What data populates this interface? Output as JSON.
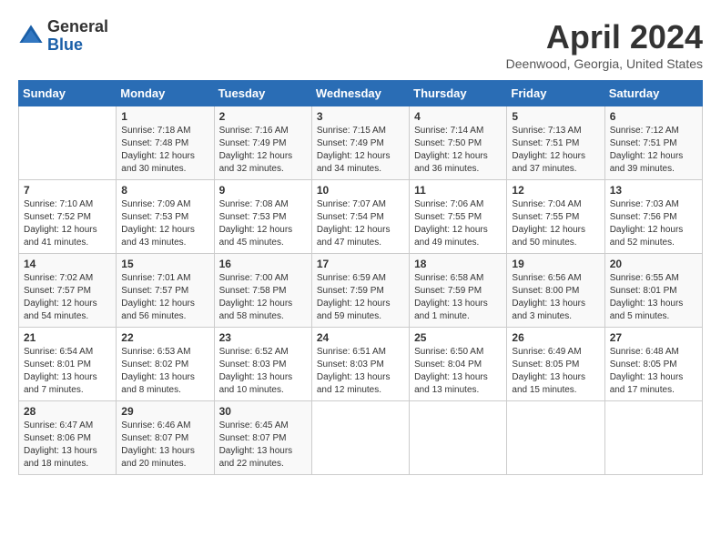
{
  "logo": {
    "general": "General",
    "blue": "Blue"
  },
  "title": "April 2024",
  "subtitle": "Deenwood, Georgia, United States",
  "days_of_week": [
    "Sunday",
    "Monday",
    "Tuesday",
    "Wednesday",
    "Thursday",
    "Friday",
    "Saturday"
  ],
  "weeks": [
    [
      {
        "day": "",
        "info": ""
      },
      {
        "day": "1",
        "info": "Sunrise: 7:18 AM\nSunset: 7:48 PM\nDaylight: 12 hours\nand 30 minutes."
      },
      {
        "day": "2",
        "info": "Sunrise: 7:16 AM\nSunset: 7:49 PM\nDaylight: 12 hours\nand 32 minutes."
      },
      {
        "day": "3",
        "info": "Sunrise: 7:15 AM\nSunset: 7:49 PM\nDaylight: 12 hours\nand 34 minutes."
      },
      {
        "day": "4",
        "info": "Sunrise: 7:14 AM\nSunset: 7:50 PM\nDaylight: 12 hours\nand 36 minutes."
      },
      {
        "day": "5",
        "info": "Sunrise: 7:13 AM\nSunset: 7:51 PM\nDaylight: 12 hours\nand 37 minutes."
      },
      {
        "day": "6",
        "info": "Sunrise: 7:12 AM\nSunset: 7:51 PM\nDaylight: 12 hours\nand 39 minutes."
      }
    ],
    [
      {
        "day": "7",
        "info": "Sunrise: 7:10 AM\nSunset: 7:52 PM\nDaylight: 12 hours\nand 41 minutes."
      },
      {
        "day": "8",
        "info": "Sunrise: 7:09 AM\nSunset: 7:53 PM\nDaylight: 12 hours\nand 43 minutes."
      },
      {
        "day": "9",
        "info": "Sunrise: 7:08 AM\nSunset: 7:53 PM\nDaylight: 12 hours\nand 45 minutes."
      },
      {
        "day": "10",
        "info": "Sunrise: 7:07 AM\nSunset: 7:54 PM\nDaylight: 12 hours\nand 47 minutes."
      },
      {
        "day": "11",
        "info": "Sunrise: 7:06 AM\nSunset: 7:55 PM\nDaylight: 12 hours\nand 49 minutes."
      },
      {
        "day": "12",
        "info": "Sunrise: 7:04 AM\nSunset: 7:55 PM\nDaylight: 12 hours\nand 50 minutes."
      },
      {
        "day": "13",
        "info": "Sunrise: 7:03 AM\nSunset: 7:56 PM\nDaylight: 12 hours\nand 52 minutes."
      }
    ],
    [
      {
        "day": "14",
        "info": "Sunrise: 7:02 AM\nSunset: 7:57 PM\nDaylight: 12 hours\nand 54 minutes."
      },
      {
        "day": "15",
        "info": "Sunrise: 7:01 AM\nSunset: 7:57 PM\nDaylight: 12 hours\nand 56 minutes."
      },
      {
        "day": "16",
        "info": "Sunrise: 7:00 AM\nSunset: 7:58 PM\nDaylight: 12 hours\nand 58 minutes."
      },
      {
        "day": "17",
        "info": "Sunrise: 6:59 AM\nSunset: 7:59 PM\nDaylight: 12 hours\nand 59 minutes."
      },
      {
        "day": "18",
        "info": "Sunrise: 6:58 AM\nSunset: 7:59 PM\nDaylight: 13 hours\nand 1 minute."
      },
      {
        "day": "19",
        "info": "Sunrise: 6:56 AM\nSunset: 8:00 PM\nDaylight: 13 hours\nand 3 minutes."
      },
      {
        "day": "20",
        "info": "Sunrise: 6:55 AM\nSunset: 8:01 PM\nDaylight: 13 hours\nand 5 minutes."
      }
    ],
    [
      {
        "day": "21",
        "info": "Sunrise: 6:54 AM\nSunset: 8:01 PM\nDaylight: 13 hours\nand 7 minutes."
      },
      {
        "day": "22",
        "info": "Sunrise: 6:53 AM\nSunset: 8:02 PM\nDaylight: 13 hours\nand 8 minutes."
      },
      {
        "day": "23",
        "info": "Sunrise: 6:52 AM\nSunset: 8:03 PM\nDaylight: 13 hours\nand 10 minutes."
      },
      {
        "day": "24",
        "info": "Sunrise: 6:51 AM\nSunset: 8:03 PM\nDaylight: 13 hours\nand 12 minutes."
      },
      {
        "day": "25",
        "info": "Sunrise: 6:50 AM\nSunset: 8:04 PM\nDaylight: 13 hours\nand 13 minutes."
      },
      {
        "day": "26",
        "info": "Sunrise: 6:49 AM\nSunset: 8:05 PM\nDaylight: 13 hours\nand 15 minutes."
      },
      {
        "day": "27",
        "info": "Sunrise: 6:48 AM\nSunset: 8:05 PM\nDaylight: 13 hours\nand 17 minutes."
      }
    ],
    [
      {
        "day": "28",
        "info": "Sunrise: 6:47 AM\nSunset: 8:06 PM\nDaylight: 13 hours\nand 18 minutes."
      },
      {
        "day": "29",
        "info": "Sunrise: 6:46 AM\nSunset: 8:07 PM\nDaylight: 13 hours\nand 20 minutes."
      },
      {
        "day": "30",
        "info": "Sunrise: 6:45 AM\nSunset: 8:07 PM\nDaylight: 13 hours\nand 22 minutes."
      },
      {
        "day": "",
        "info": ""
      },
      {
        "day": "",
        "info": ""
      },
      {
        "day": "",
        "info": ""
      },
      {
        "day": "",
        "info": ""
      }
    ]
  ]
}
